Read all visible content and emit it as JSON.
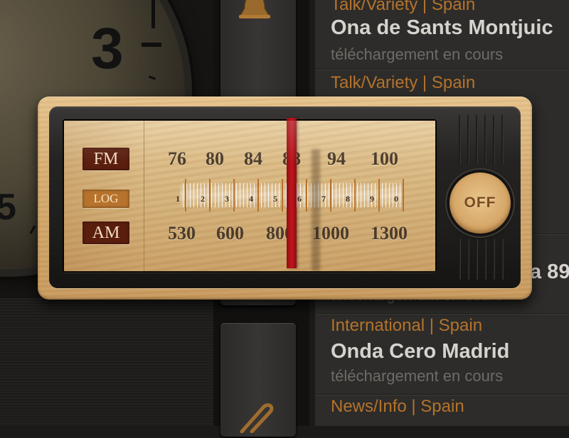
{
  "clock": {
    "numerals": [
      "3",
      "5"
    ]
  },
  "stations": [
    {
      "genre": "Talk/Variety | Spain",
      "name": "Ona de Sants Montjuic",
      "status": "téléchargement en cours"
    },
    {
      "genre": "Talk/Variety | Spain",
      "name": "",
      "status": ""
    },
    {
      "genre": "",
      "name": "a 89",
      "status": "téléchargement en cours"
    },
    {
      "genre": "International | Spain",
      "name": "Onda Cero Madrid",
      "status": "téléchargement en cours"
    },
    {
      "genre": "News/Info | Spain",
      "name": "",
      "status": ""
    }
  ],
  "radio": {
    "bands": {
      "fm": "FM",
      "log": "LOG",
      "am": "AM"
    },
    "fm_scale": [
      "76",
      "80",
      "84",
      "88",
      "94",
      "100"
    ],
    "log_scale": [
      "1",
      "2",
      "3",
      "4",
      "5",
      "6",
      "7",
      "8",
      "9",
      "0"
    ],
    "am_scale": [
      "530",
      "600",
      "800",
      "1000",
      "1300"
    ],
    "off_button": "OFF",
    "needle_color": "#c0161c"
  },
  "icons": {
    "bell": "bell-icon",
    "paperclip": "paperclip-icon"
  },
  "colors": {
    "genre": "#b4732c",
    "station_name": "#d6d3ce",
    "status": "#6e6b66",
    "band_dark": "#5a1e0e",
    "band_log": "#b7732d"
  }
}
